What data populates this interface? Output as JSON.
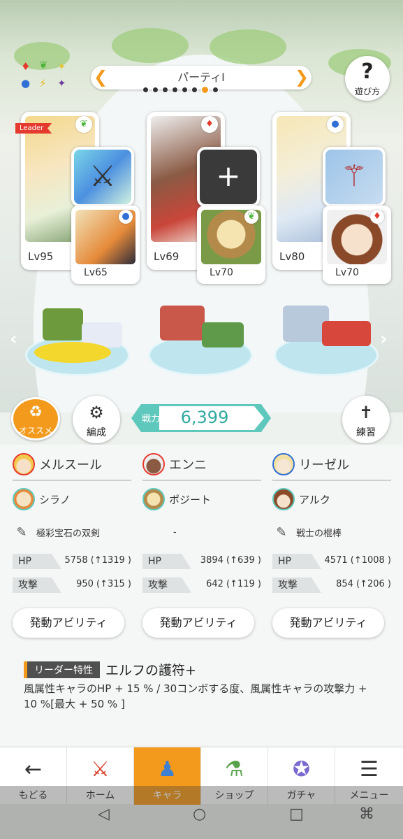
{
  "header": {
    "title": "パーティI",
    "page_dots": 8,
    "active_dot": 7,
    "help_label": "遊び方"
  },
  "element_icons": [
    "♦",
    "❦",
    "✦",
    "●",
    "⚡",
    "✦"
  ],
  "colors": {
    "accent": "#f39a1d",
    "teal": "#5ec8bd",
    "fire": "#e43b2e",
    "wind": "#4bb33a",
    "water": "#2f6fd6"
  },
  "party": [
    {
      "leader": "Leader",
      "main_lv": "Lv95",
      "sub_lv": "Lv65",
      "main_attr": "wind",
      "sub_attr": "water"
    },
    {
      "main_lv": "Lv69",
      "sub_lv": "Lv70",
      "main_attr": "fire",
      "sub_attr": "wind"
    },
    {
      "main_lv": "Lv80",
      "sub_lv": "Lv70",
      "main_attr": "water",
      "sub_attr": "fire"
    }
  ],
  "actions": {
    "recommend_label": "オススメ",
    "formation_label": "編成",
    "power_label": "戦力",
    "power_value": "6,399",
    "practice_label": "練習"
  },
  "members": [
    {
      "main": "メルスール",
      "sub": "シラノ",
      "weapon": "極彩宝石の双剣",
      "hp_label": "HP",
      "hp": "5758 (↑1319 )",
      "atk_label": "攻撃",
      "atk": "950 (↑315 )",
      "ability": "発動アビリティ"
    },
    {
      "main": "エンニ",
      "sub": "ポジート",
      "weapon": "-",
      "hp_label": "HP",
      "hp": "3894 (↑639 )",
      "atk_label": "攻撃",
      "atk": "642 (↑119 )",
      "ability": "発動アビリティ"
    },
    {
      "main": "リーゼル",
      "sub": "アルク",
      "weapon": "戦士の棍棒",
      "hp_label": "HP",
      "hp": "4571 (↑1008 )",
      "atk_label": "攻撃",
      "atk": "854 (↑206 )",
      "ability": "発動アビリティ"
    }
  ],
  "leader_skill": {
    "tag": "リーダー特性",
    "name": "エルフの護符+",
    "desc": "風属性キャラのHP + 15 % / 30コンボする度、風属性キャラの攻撃力 + 10 %[最大 + 50 % ]"
  },
  "nav": [
    {
      "label": "もどる",
      "icon": "back-arrow-icon"
    },
    {
      "label": "ホーム",
      "icon": "home-icon"
    },
    {
      "label": "キャラ",
      "icon": "character-icon"
    },
    {
      "label": "ショップ",
      "icon": "shop-icon"
    },
    {
      "label": "ガチャ",
      "icon": "gacha-icon"
    },
    {
      "label": "メニュー",
      "icon": "menu-icon"
    }
  ],
  "active_nav": 2,
  "system_nav": [
    "back",
    "home",
    "recents",
    "game"
  ]
}
